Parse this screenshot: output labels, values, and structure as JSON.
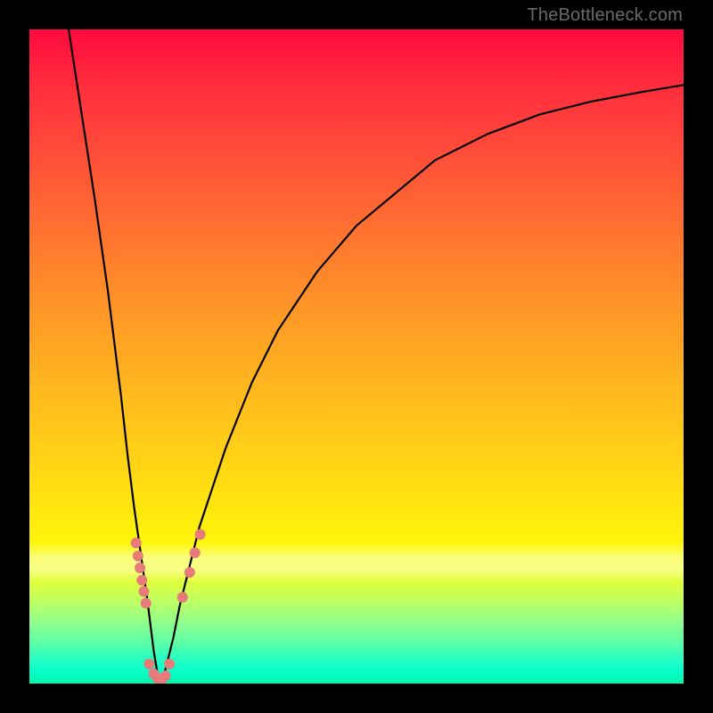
{
  "attribution": "TheBottleneck.com",
  "chart_data": {
    "type": "line",
    "title": "",
    "xlabel": "",
    "ylabel": "",
    "xlim": [
      0,
      100
    ],
    "ylim": [
      0,
      100
    ],
    "grid": false,
    "series": [
      {
        "name": "bottleneck-curve",
        "x": [
          6,
          8,
          10,
          12,
          14,
          15,
          16,
          17,
          18,
          18.5,
          19,
          19.5,
          20,
          20.5,
          21,
          22,
          23,
          24,
          26,
          28,
          30,
          34,
          38,
          44,
          50,
          56,
          62,
          70,
          78,
          86,
          94,
          100
        ],
        "y": [
          100,
          87,
          74,
          60,
          44,
          35,
          27,
          20,
          13,
          9,
          5,
          2,
          0,
          1,
          3,
          7,
          12,
          16,
          24,
          30,
          36,
          46,
          54,
          63,
          70,
          75,
          80,
          84,
          87,
          89,
          90.5,
          91.5
        ]
      }
    ],
    "markers": {
      "name": "highlighted-points",
      "color": "#e77a7a",
      "points": [
        {
          "x": 16.3,
          "y": 21.5,
          "r": 6
        },
        {
          "x": 16.6,
          "y": 19.5,
          "r": 6
        },
        {
          "x": 16.9,
          "y": 17.7,
          "r": 6
        },
        {
          "x": 17.2,
          "y": 15.8,
          "r": 6
        },
        {
          "x": 17.5,
          "y": 14.1,
          "r": 6
        },
        {
          "x": 17.8,
          "y": 12.3,
          "r": 6
        },
        {
          "x": 18.3,
          "y": 3.0,
          "r": 6
        },
        {
          "x": 19.0,
          "y": 1.5,
          "r": 6
        },
        {
          "x": 19.6,
          "y": 0.8,
          "r": 6
        },
        {
          "x": 20.2,
          "y": 0.6,
          "r": 6
        },
        {
          "x": 20.8,
          "y": 1.2,
          "r": 6
        },
        {
          "x": 21.4,
          "y": 3.0,
          "r": 6
        },
        {
          "x": 23.4,
          "y": 13.2,
          "r": 6
        },
        {
          "x": 24.5,
          "y": 17.0,
          "r": 6
        },
        {
          "x": 25.3,
          "y": 20.0,
          "r": 6
        },
        {
          "x": 26.1,
          "y": 22.8,
          "r": 6
        }
      ]
    },
    "gradient_stops": [
      {
        "pos": 0,
        "color": "#ff0a3e"
      },
      {
        "pos": 18,
        "color": "#ff4a3a"
      },
      {
        "pos": 42,
        "color": "#ff9428"
      },
      {
        "pos": 66,
        "color": "#ffd315"
      },
      {
        "pos": 80,
        "color": "#fff40a"
      },
      {
        "pos": 90,
        "color": "#8aff90"
      },
      {
        "pos": 100,
        "color": "#00f7a8"
      }
    ]
  }
}
